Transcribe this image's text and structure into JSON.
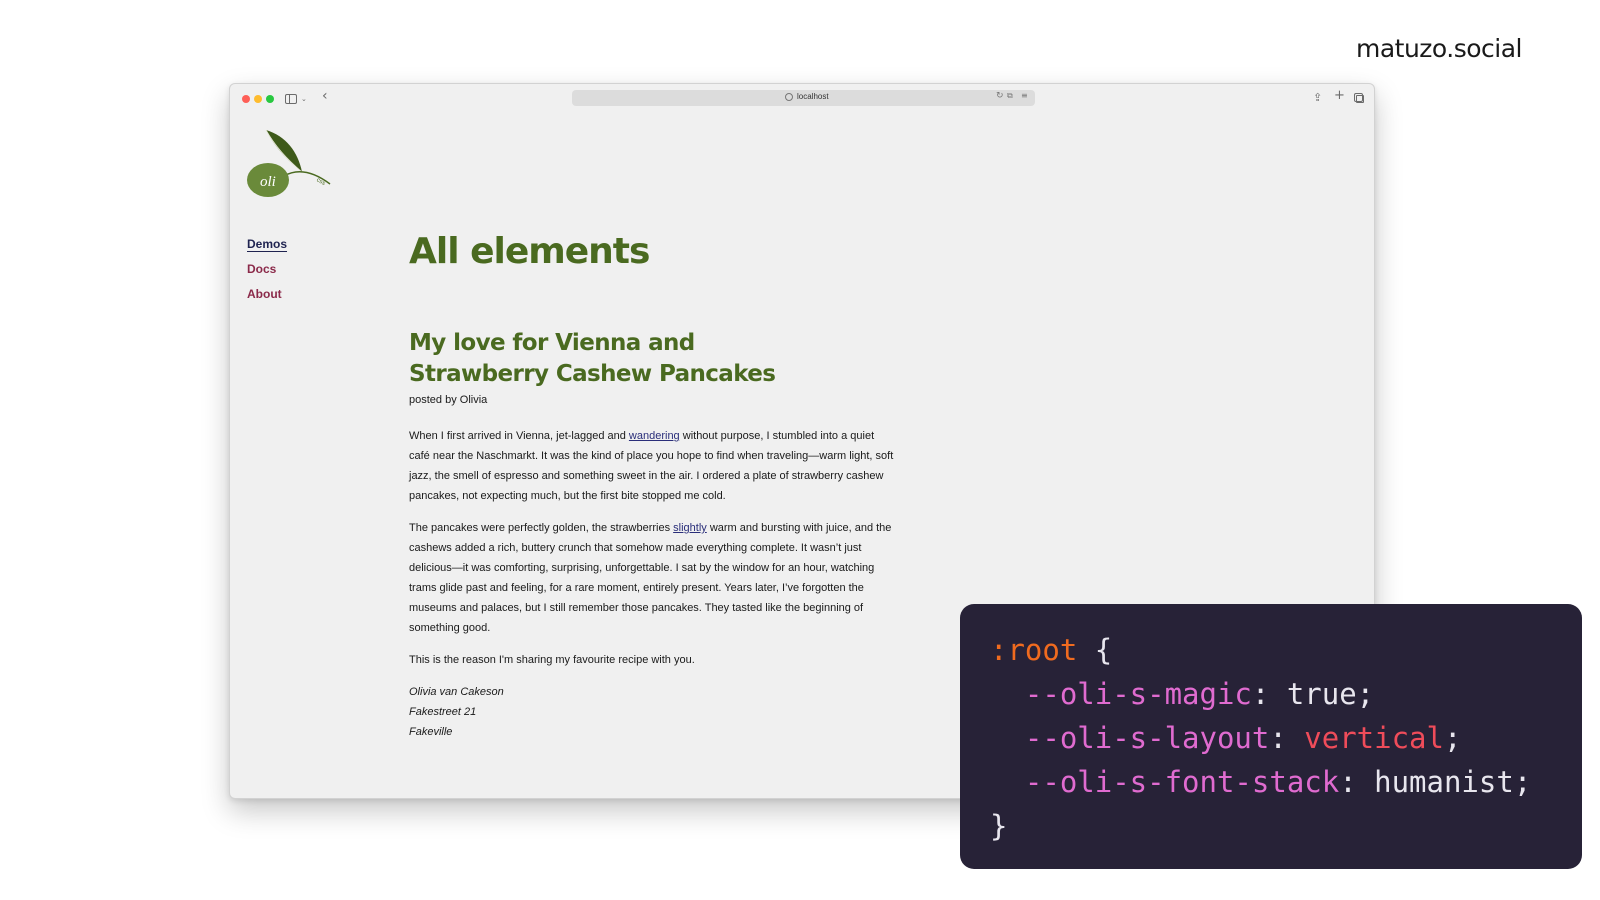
{
  "brand": "matuzo.social",
  "browser": {
    "url": "localhost"
  },
  "site": {
    "logo_text": "oli",
    "logo_sub": "css",
    "nav": [
      {
        "label": "Demos",
        "active": true
      },
      {
        "label": "Docs",
        "active": false
      },
      {
        "label": "About",
        "active": false
      }
    ]
  },
  "main": {
    "page_title": "All elements",
    "post_title_line1": "My love for Vienna and",
    "post_title_line2": "Strawberry Cashew Pancakes",
    "byline": "posted by Olivia",
    "p1_a": "When I first arrived in Vienna, jet-lagged and ",
    "p1_link": "wandering",
    "p1_b": " without purpose, I stumbled into a quiet café near the Naschmarkt. It was the kind of place you hope to find when traveling—warm light, soft jazz, the smell of espresso and something sweet in the air. I ordered a plate of strawberry cashew pancakes, not expecting much, but the first bite stopped me cold.",
    "p2_a": "The pancakes were perfectly golden, the strawberries ",
    "p2_link": "slightly",
    "p2_b": " warm and bursting with juice, and the cashews added a rich, buttery crunch that somehow made everything complete. It wasn’t just delicious—it was comforting, surprising, unforgettable. I sat by the window for an hour, watching trams glide past and feeling, for a rare moment, entirely present. Years later, I’ve forgotten the museums and palaces, but I still remember those pancakes. They tasted like the beginning of something good.",
    "p3": "This is the reason I'm sharing my favourite recipe with you.",
    "address": [
      "Olivia van Cakeson",
      "Fakestreet 21",
      "Fakeville"
    ]
  },
  "code": {
    "selector": ":root",
    "open": "{",
    "close": "}",
    "decls": [
      {
        "prop": "--oli-s-magic",
        "value": "true"
      },
      {
        "prop": "--oli-s-layout",
        "value": "vertical"
      },
      {
        "prop": "--oli-s-font-stack",
        "value": "humanist"
      }
    ]
  }
}
